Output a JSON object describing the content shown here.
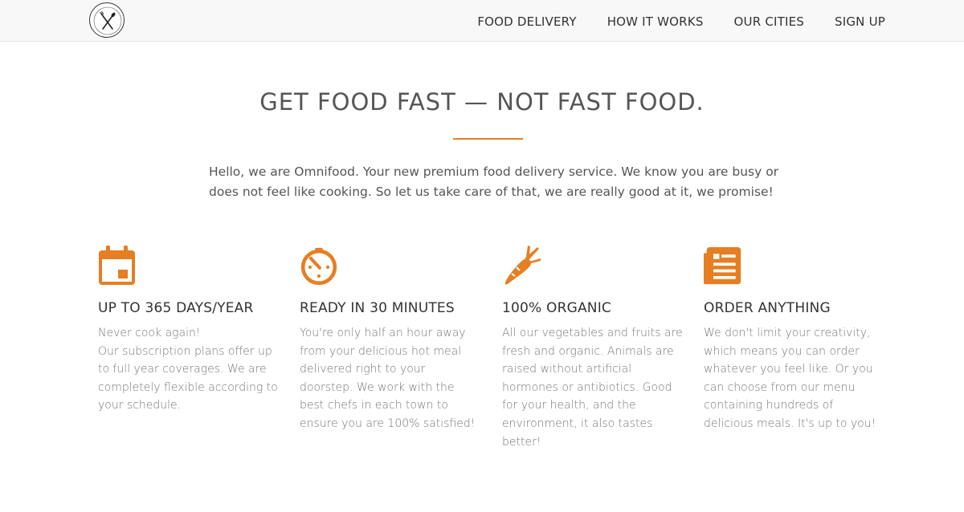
{
  "nav": {
    "logo_icon": "fork-knife-logo-icon",
    "links": [
      "FOOD DELIVERY",
      "HOW IT WORKS",
      "OUR CITIES",
      "SIGN UP"
    ]
  },
  "hero": {
    "title": "GET FOOD FAST — NOT FAST FOOD.",
    "intro": "Hello, we are Omnifood. Your new premium food delivery service. We know you are busy or does not feel like cooking. So let us take care of that, we are really good at it, we promise!"
  },
  "features": [
    {
      "icon": "calendar-icon",
      "title": "UP TO 365 DAYS/YEAR",
      "text_line1": "Never cook again!",
      "text_rest": "Our subscription plans offer up to full year coverages. We are completely flexible according to your schedule."
    },
    {
      "icon": "stopwatch-icon",
      "title": "READY IN 30 MINUTES",
      "text": "You're only half an hour away from your delicious hot meal delivered right to your doorstep. We work with the best chefs in each town to ensure you are 100% satisfied!"
    },
    {
      "icon": "carrot-icon",
      "title": "100% ORGANIC",
      "text": "All our vegetables and fruits are fresh and organic. Animals are raised without artificial hormones or antibiotics. Good for your health, and the environment, it also tastes better!"
    },
    {
      "icon": "document-icon",
      "title": "ORDER ANYTHING",
      "text": "We don't limit your creativity, which means you can order whatever you feel like. Or you can choose from our menu containing hundreds of delicious meals. It's up to you!"
    }
  ],
  "colors": {
    "accent": "#e67e22",
    "nav_bg": "#f8f8f8",
    "text": "#555555"
  }
}
